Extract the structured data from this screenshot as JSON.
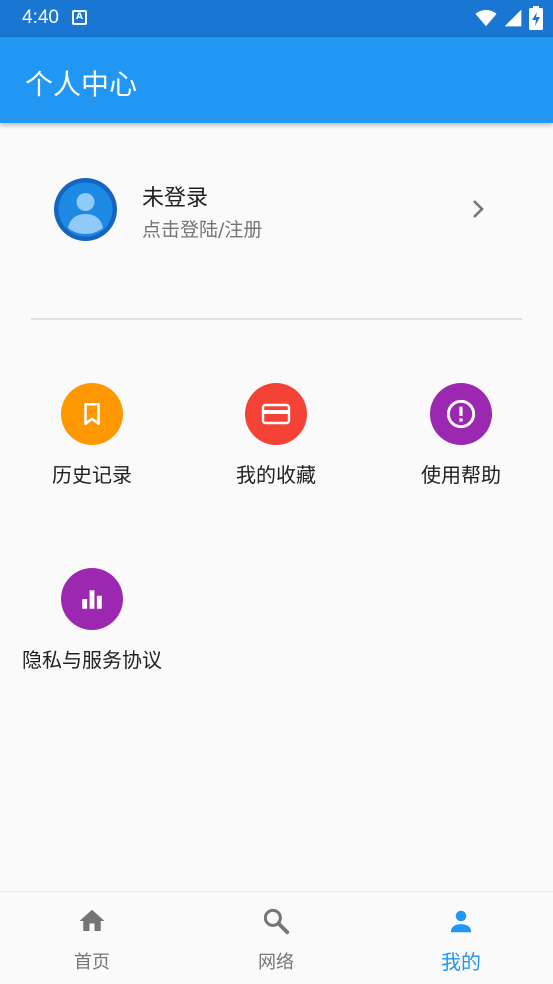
{
  "status_bar": {
    "time": "4:40",
    "notification_icon": "A"
  },
  "app_bar": {
    "title": "个人中心"
  },
  "profile": {
    "name": "未登录",
    "subtitle": "点击登陆/注册"
  },
  "menu": [
    {
      "label": "历史记录",
      "color": "#ff9800",
      "icon": "bookmark-icon"
    },
    {
      "label": "我的收藏",
      "color": "#f44336",
      "icon": "credit-card-icon"
    },
    {
      "label": "使用帮助",
      "color": "#9c27b0",
      "icon": "info-icon"
    },
    {
      "label": "隐私与服务协议",
      "color": "#9c27b0",
      "icon": "bar-chart-icon"
    }
  ],
  "bottom_nav": [
    {
      "label": "首页",
      "icon": "home-icon",
      "active": false
    },
    {
      "label": "网络",
      "icon": "search-icon",
      "active": false
    },
    {
      "label": "我的",
      "icon": "person-icon",
      "active": true
    }
  ],
  "colors": {
    "primary": "#2196f3",
    "primary_dark": "#1976d2"
  }
}
